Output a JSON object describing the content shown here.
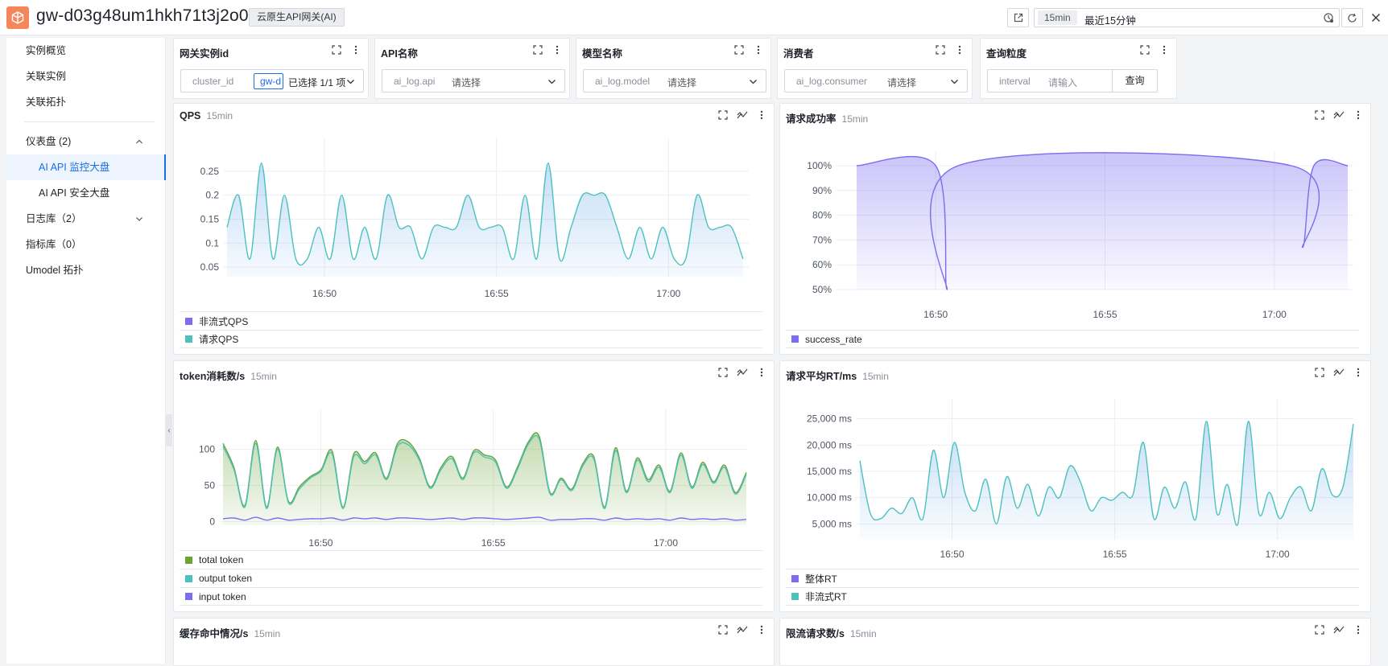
{
  "header": {
    "title": "gw-d03g48um1hkh71t3j2o0",
    "type_badge": "云原生API网关(AI)",
    "time_short": "15min",
    "time_label": "最近15分钟"
  },
  "sidebar": {
    "items": [
      {
        "label": "实例概览"
      },
      {
        "label": "关联实例"
      },
      {
        "label": "关联拓扑"
      },
      {
        "label": "仪表盘 (2)"
      },
      {
        "label": "AI API 监控大盘"
      },
      {
        "label": "AI API 安全大盘"
      },
      {
        "label": "日志库（2）"
      },
      {
        "label": "指标库（0）"
      },
      {
        "label": "Umodel 拓扑"
      }
    ]
  },
  "filters": [
    {
      "title": "网关实例id",
      "key": "cluster_id",
      "tag": "gw-d",
      "value": "已选择 1/1 项"
    },
    {
      "title": "API名称",
      "key": "ai_log.api",
      "placeholder": "请选择"
    },
    {
      "title": "模型名称",
      "key": "ai_log.model",
      "placeholder": "请选择"
    },
    {
      "title": "消费者",
      "key": "ai_log.consumer",
      "placeholder": "请选择"
    },
    {
      "title": "查询粒度",
      "key": "interval",
      "placeholder": "请输入",
      "button": "查询"
    }
  ],
  "panels": {
    "qps": {
      "title": "QPS",
      "range": "15min"
    },
    "success": {
      "title": "请求成功率",
      "range": "15min"
    },
    "token": {
      "title": "token消耗数/s",
      "range": "15min"
    },
    "rt": {
      "title": "请求平均RT/ms",
      "range": "15min"
    },
    "cache": {
      "title": "缓存命中情况/s",
      "range": "15min"
    },
    "ratelimit": {
      "title": "限流请求数/s",
      "range": "15min"
    }
  },
  "colors": {
    "teal": "#4cc2bd",
    "purple": "#7b6cf0",
    "green": "#6aa336",
    "accent": "#1a6ee8",
    "logo": "#f5855b"
  },
  "chart_data": [
    {
      "type": "area",
      "title": "QPS",
      "x_ticks": [
        "16:50",
        "16:55",
        "17:00"
      ],
      "x": [
        "16:47:10",
        "16:47:30",
        "16:47:50",
        "16:48:10",
        "16:48:30",
        "16:48:50",
        "16:49:10",
        "16:49:30",
        "16:49:50",
        "16:50:10",
        "16:50:30",
        "16:50:50",
        "16:51:10",
        "16:51:30",
        "16:51:50",
        "16:52:10",
        "16:52:30",
        "16:52:50",
        "16:53:10",
        "16:53:30",
        "16:53:50",
        "16:54:10",
        "16:54:30",
        "16:54:50",
        "16:55:10",
        "16:55:30",
        "16:55:50",
        "16:56:10",
        "16:56:30",
        "16:56:50",
        "16:57:10",
        "16:57:30",
        "16:57:50",
        "16:58:10",
        "16:58:30",
        "16:58:50",
        "16:59:10",
        "16:59:30",
        "16:59:50",
        "17:00:10",
        "17:00:30",
        "17:00:50",
        "17:01:10",
        "17:01:30",
        "17:01:50",
        "17:02:10"
      ],
      "y_ticks": [
        0.05,
        0.1,
        0.15,
        0.2,
        0.25
      ],
      "ylim": [
        0.03,
        0.29
      ],
      "series": [
        {
          "name": "非流式QPS",
          "values": []
        },
        {
          "name": "请求QPS",
          "values": [
            0.133,
            0.2,
            0.067,
            0.267,
            0.067,
            0.2,
            0.067,
            0.067,
            0.133,
            0.067,
            0.2,
            0.067,
            0.133,
            0.067,
            0.2,
            0.133,
            0.133,
            0.067,
            0.133,
            0.133,
            0.133,
            0.2,
            0.133,
            0.133,
            0.133,
            0.067,
            0.2,
            0.067,
            0.267,
            0.067,
            0.133,
            0.2,
            0.2,
            0.2,
            0.133,
            0.067,
            0.133,
            0.067,
            0.133,
            0.067,
            0.067,
            0.2,
            0.133,
            0.133,
            0.133,
            0.067
          ]
        }
      ],
      "legend_position": "bottom"
    },
    {
      "type": "area",
      "title": "请求成功率",
      "x_ticks": [
        "16:50",
        "16:55",
        "17:00"
      ],
      "x": [
        "16:47:40",
        "16:50:00",
        "16:50:20",
        "16:50:40",
        "17:00:30",
        "17:00:50",
        "17:01:10",
        "17:02:10"
      ],
      "y_ticks": [
        "50%",
        "60%",
        "70%",
        "80%",
        "90%",
        "100%"
      ],
      "ylim": [
        50,
        100
      ],
      "series": [
        {
          "name": "success_rate",
          "values": [
            100,
            100,
            50,
            100,
            100,
            67,
            100,
            100
          ]
        }
      ],
      "legend_position": "bottom"
    },
    {
      "type": "area",
      "title": "token消耗数/s",
      "x_ticks": [
        "16:50",
        "16:55",
        "17:00"
      ],
      "y_ticks": [
        0,
        50,
        100
      ],
      "ylim": [
        -5,
        135
      ],
      "series": [
        {
          "name": "total token",
          "values": [
            108,
            75,
            22,
            112,
            20,
            103,
            28,
            48,
            62,
            72,
            98,
            20,
            94,
            83,
            95,
            60,
            108,
            110,
            88,
            48,
            75,
            90,
            60,
            98,
            92,
            85,
            48,
            75,
            110,
            118,
            40,
            60,
            45,
            80,
            90,
            20,
            102,
            42,
            88,
            58,
            78,
            42,
            95,
            48,
            82,
            55,
            78,
            40,
            68
          ]
        },
        {
          "name": "output token",
          "values": [
            104,
            72,
            20,
            108,
            18,
            100,
            26,
            45,
            60,
            70,
            94,
            18,
            90,
            80,
            92,
            58,
            104,
            106,
            85,
            46,
            72,
            87,
            58,
            95,
            89,
            82,
            46,
            72,
            107,
            114,
            38,
            58,
            43,
            77,
            87,
            18,
            98,
            40,
            85,
            55,
            75,
            40,
            92,
            46,
            79,
            53,
            75,
            38,
            65
          ]
        },
        {
          "name": "input token",
          "values": [
            4,
            5,
            2,
            6,
            2,
            5,
            2,
            3,
            4,
            4,
            5,
            2,
            5,
            4,
            5,
            3,
            5,
            5,
            4,
            3,
            4,
            5,
            3,
            5,
            5,
            4,
            3,
            4,
            5,
            6,
            2,
            3,
            3,
            4,
            4,
            2,
            5,
            3,
            4,
            3,
            4,
            2,
            5,
            3,
            4,
            3,
            4,
            2,
            3
          ]
        }
      ],
      "legend_position": "bottom"
    },
    {
      "type": "area",
      "title": "请求平均RT/ms",
      "x_ticks": [
        "16:50",
        "16:55",
        "17:00"
      ],
      "y_ticks": [
        "5,000 ms",
        "10,000 ms",
        "15,000 ms",
        "20,000 ms",
        "25,000 ms"
      ],
      "ylim": [
        2000,
        26000
      ],
      "series": [
        {
          "name": "整体RT",
          "values": []
        },
        {
          "name": "非流式RT",
          "values": [
            17000,
            7000,
            6000,
            8000,
            7000,
            10000,
            6000,
            19000,
            10000,
            20500,
            11000,
            7500,
            13500,
            5000,
            14000,
            8000,
            12500,
            6500,
            12000,
            10000,
            16000,
            13000,
            7500,
            10000,
            9500,
            11000,
            10500,
            20500,
            6000,
            12000,
            8000,
            13000,
            6000,
            24500,
            7000,
            12500,
            5000,
            24500,
            7000,
            11000,
            6000,
            10000,
            12000,
            7500,
            15500,
            10500,
            12000,
            24000
          ]
        }
      ],
      "legend_position": "bottom"
    }
  ]
}
